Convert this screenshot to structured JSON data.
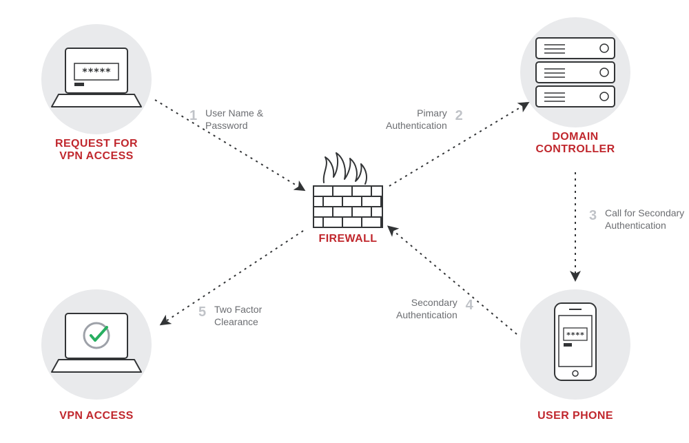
{
  "nodes": {
    "request": {
      "label": "REQUEST FOR\nVPN ACCESS"
    },
    "firewall": {
      "label": "FIREWALL"
    },
    "domain": {
      "label": "DOMAIN\nCONTROLLER"
    },
    "phone": {
      "label": "USER PHONE"
    },
    "access": {
      "label": "VPN ACCESS"
    }
  },
  "steps": {
    "s1": {
      "num": "1",
      "text": "User Name &\nPassword"
    },
    "s2": {
      "num": "2",
      "text": "Pimary\nAuthentication"
    },
    "s3": {
      "num": "3",
      "text": "Call for Secondary\nAuthentication"
    },
    "s4": {
      "num": "4",
      "text": "Secondary\nAuthentication"
    },
    "s5": {
      "num": "5",
      "text": "Two Factor\nClearance"
    }
  },
  "colors": {
    "accent": "#c0272d",
    "circle": "#e9eaec",
    "line": "#323436",
    "step_num": "#c0c3c8",
    "step_text": "#6b6d71",
    "success": "#27ae60"
  }
}
